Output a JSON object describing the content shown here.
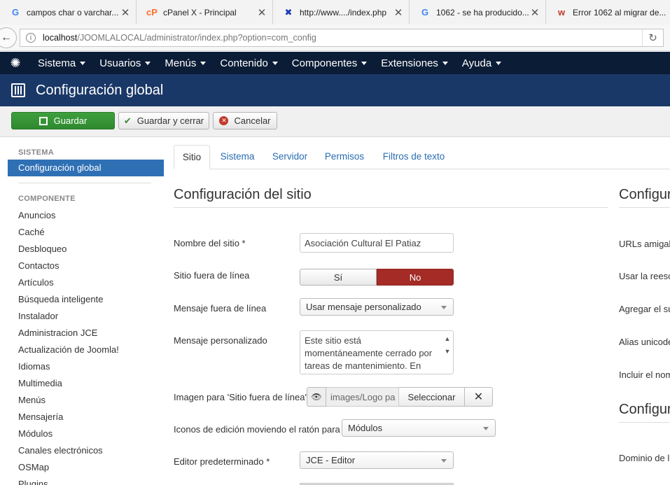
{
  "browser_tabs": [
    {
      "title": "campos char o varchar...",
      "icon": "google-icon",
      "color": "#4285f4"
    },
    {
      "title": "cPanel X - Principal",
      "icon": "cpanel-icon",
      "color": "#ff6c2c"
    },
    {
      "title": "http://www..../index.php",
      "icon": "joomla-icon",
      "color": "#1a3bb5"
    },
    {
      "title": "1062 - se ha producido...",
      "icon": "google-icon",
      "color": "#4285f4"
    },
    {
      "title": "Error 1062 al migrar de...",
      "icon": "web-icon",
      "color": "#c0392b"
    }
  ],
  "address": {
    "host": "localhost",
    "path": "/JOOMLALOCAL/administrator/index.php?option=com_config"
  },
  "navbar": {
    "items": [
      "Sistema",
      "Usuarios",
      "Menús",
      "Contenido",
      "Componentes",
      "Extensiones",
      "Ayuda"
    ]
  },
  "page_title": "Configuración global",
  "toolbar": {
    "save": "Guardar",
    "save_close": "Guardar y cerrar",
    "cancel": "Cancelar"
  },
  "sidebar": {
    "system_header": "SISTEMA",
    "active_item": "Configuración global",
    "component_header": "COMPONENTE",
    "items": [
      "Anuncios",
      "Caché",
      "Desbloqueo",
      "Contactos",
      "Artículos",
      "Búsqueda inteligente",
      "Instalador",
      "Administracion JCE",
      "Actualización de Joomla!",
      "Idiomas",
      "Multimedia",
      "Menús",
      "Mensajería",
      "Módulos",
      "Canales electrónicos",
      "OSMap",
      "Plugins"
    ]
  },
  "tabs": [
    "Sitio",
    "Sistema",
    "Servidor",
    "Permisos",
    "Filtros de texto"
  ],
  "site": {
    "section_title": "Configuración del sitio",
    "site_name_label": "Nombre del sitio *",
    "site_name_value": "Asociación Cultural El Patiaz",
    "offline_label": "Sitio fuera de línea",
    "offline_yes": "Sí",
    "offline_no": "No",
    "offline_msg_label": "Mensaje fuera de línea",
    "offline_msg_value": "Usar mensaje personalizado",
    "custom_msg_label": "Mensaje personalizado",
    "custom_msg_value": "Este sitio está momentáneamente cerrado por tareas de mantenimiento. En",
    "offline_image_label": "Imagen para 'Sitio fuera de línea'",
    "offline_image_value": "images/Logo pa",
    "offline_image_select": "Seleccionar",
    "edit_icons_label": "Iconos de edición moviendo el ratón para",
    "edit_icons_value": "Módulos",
    "editor_label": "Editor predeterminado *",
    "editor_value": "JCE - Editor"
  },
  "right_column": {
    "section_title_1": "Configur",
    "labels": [
      "URLs amigal",
      "Usar la reesc",
      "Agregar el su",
      "Alias unicode",
      "Incluir el nom"
    ],
    "section_title_2": "Configur",
    "label_domain": "Dominio de l"
  }
}
